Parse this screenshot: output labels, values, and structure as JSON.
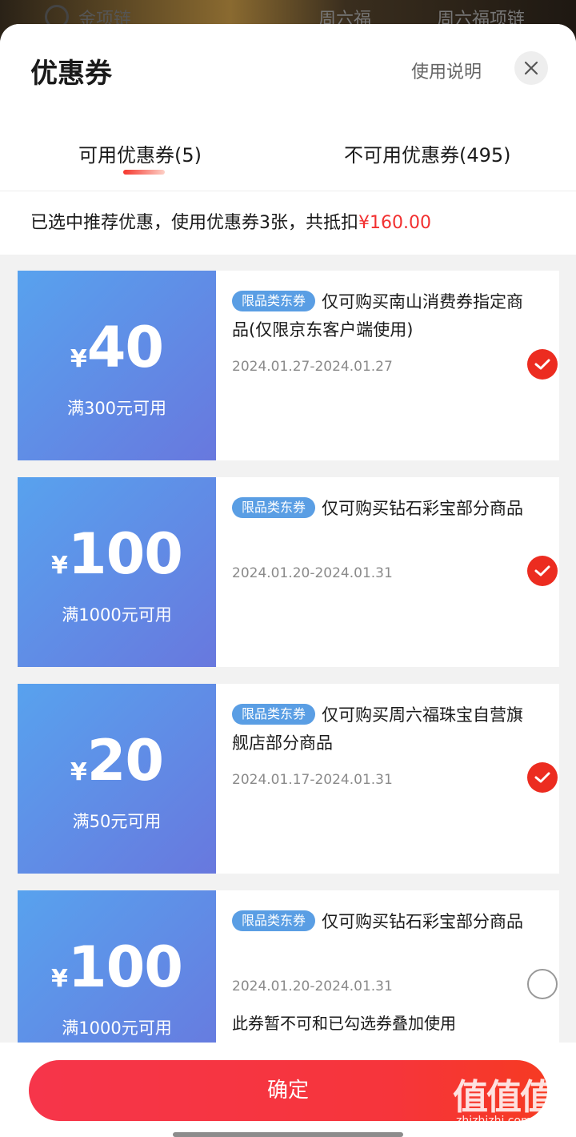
{
  "background_search": {
    "query": "金项链",
    "tag_1": "周六福",
    "tag_2": "周六福项链"
  },
  "sheet": {
    "title": "优惠券",
    "help_label": "使用说明",
    "close_icon": "close-icon"
  },
  "tabs": {
    "available": "可用优惠券(5)",
    "unavailable": "不可用优惠券(495)"
  },
  "summary": {
    "text": "已选中推荐优惠，使用优惠券3张，共抵扣",
    "amount": "¥160.00"
  },
  "coupons": [
    {
      "currency": "¥",
      "amount": "40",
      "condition": "满300元可用",
      "tag": "限品类东券",
      "description": "仅可购买南山消费券指定商品(仅限京东客户端使用)",
      "validity": "2024.01.27-2024.01.27",
      "selected": true
    },
    {
      "currency": "¥",
      "amount": "100",
      "condition": "满1000元可用",
      "tag": "限品类东券",
      "description": "仅可购买钻石彩宝部分商品",
      "validity": "2024.01.20-2024.01.31",
      "selected": true
    },
    {
      "currency": "¥",
      "amount": "20",
      "condition": "满50元可用",
      "tag": "限品类东券",
      "description": "仅可购买周六福珠宝自营旗舰店部分商品",
      "validity": "2024.01.17-2024.01.31",
      "selected": true
    },
    {
      "currency": "¥",
      "amount": "100",
      "condition": "满1000元可用",
      "tag": "限品类东券",
      "description": "仅可购买钻石彩宝部分商品",
      "validity": "2024.01.20-2024.01.31",
      "note": "此券暂不可和已勾选券叠加使用",
      "selected": false
    }
  ],
  "footer": {
    "confirm_label": "确定"
  },
  "watermark": {
    "logo": "值值值",
    "url": "zhizhizhi.com"
  },
  "colors": {
    "accent_red": "#f23030",
    "coupon_blue_start": "#58a2ee",
    "coupon_blue_end": "#6878de",
    "tag_blue": "#5a9ee4",
    "check_red": "#ec2c20"
  }
}
